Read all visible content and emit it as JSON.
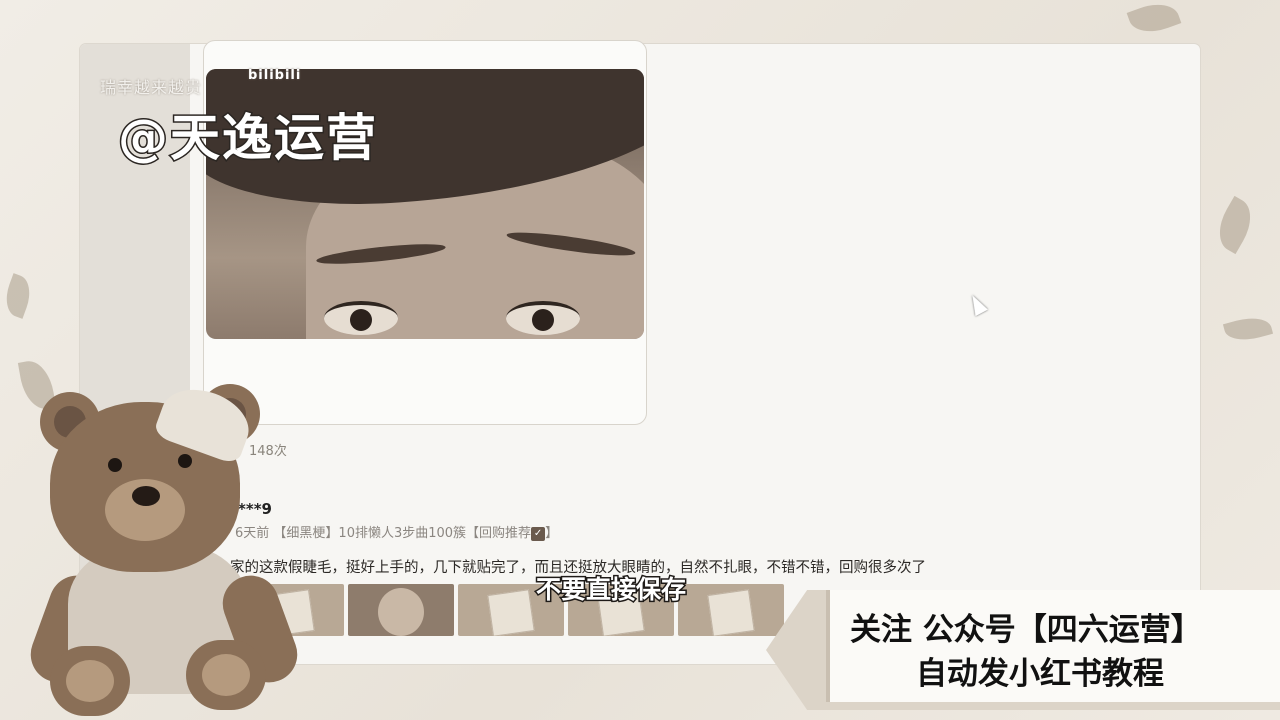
{
  "overlay": {
    "watermark_small": "瑞幸越来越贵",
    "bili_logo": "bilibili",
    "watermark_big": "@天逸运营",
    "subtitle": "不要直接保存",
    "banner_line1": "关注 公众号【四六运营】",
    "banner_line2": "自动发小红书教程"
  },
  "post": {
    "view_count": "148次",
    "comment": {
      "username": "***9",
      "time": "6天前",
      "tags": "【细黑梗】10排懒人3步曲100簇【回购推荐",
      "tags_end": "】",
      "text": "家的这款假睫毛，挺好上手的，几下就贴完了，而且还挺放大眼睛的，自然不扎眼，不错不错，回购很多次了"
    },
    "thumbnails": [
      "product-box",
      "face-photo",
      "product-box",
      "product-box",
      "product-box"
    ]
  },
  "icons": {
    "check_glyph": "✓",
    "cursor": "arrow-cursor-icon"
  }
}
